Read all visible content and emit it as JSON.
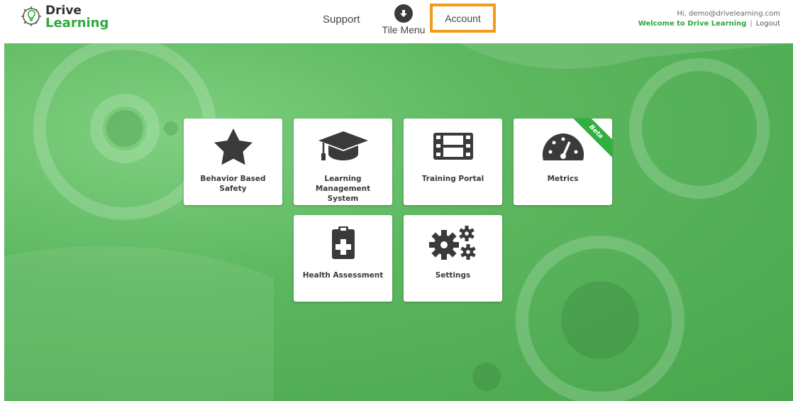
{
  "brand": {
    "line1": "Drive",
    "line2": "Learning"
  },
  "nav": {
    "support": "Support",
    "tile_menu": "Tile Menu",
    "account": "Account"
  },
  "user": {
    "greeting": "Hi, demo@drivelearning.com",
    "welcome": "Welcome to Drive Learning",
    "separator": "|",
    "logout": "Logout"
  },
  "tiles": [
    {
      "label": "Behavior Based Safety",
      "icon": "star-icon"
    },
    {
      "label": "Learning Management System",
      "icon": "graduation-cap-icon"
    },
    {
      "label": "Training Portal",
      "icon": "film-icon"
    },
    {
      "label": "Metrics",
      "icon": "speedometer-icon",
      "badge": "Beta"
    },
    {
      "label": "Health Assessment",
      "icon": "medical-clipboard-icon"
    },
    {
      "label": "Settings",
      "icon": "gears-icon"
    }
  ],
  "colors": {
    "brand_green": "#2eaa3e",
    "highlight_orange": "#f39a1d",
    "icon_dark": "#3a3a3a"
  }
}
